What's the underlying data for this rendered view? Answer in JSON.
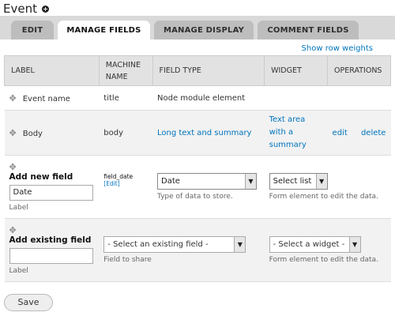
{
  "header": {
    "title": "Event",
    "shortcut_glyph": "+"
  },
  "tabs": [
    {
      "label": "EDIT",
      "active": false
    },
    {
      "label": "MANAGE FIELDS",
      "active": true
    },
    {
      "label": "MANAGE DISPLAY",
      "active": false
    },
    {
      "label": "COMMENT FIELDS",
      "active": false
    }
  ],
  "row_weights_link": "Show row weights",
  "table": {
    "headers": {
      "label": "LABEL",
      "machine_name": "MACHINE NAME",
      "field_type": "FIELD TYPE",
      "widget": "WIDGET",
      "operations": "OPERATIONS"
    },
    "rows": [
      {
        "label": "Event name",
        "machine_name": "title",
        "field_type": "Node module element"
      },
      {
        "label": "Body",
        "machine_name": "body",
        "field_type": "Long text and summary",
        "widget": "Text area with a summary",
        "edit": "edit",
        "delete": "delete"
      }
    ],
    "new_field": {
      "heading": "Add new field",
      "label_value": "Date",
      "label_caption": "Label",
      "machine_name": "field_date",
      "machine_edit": "[Edit]",
      "type_selected": "Date",
      "type_desc": "Type of data to store.",
      "widget_selected": "Select list",
      "widget_desc": "Form element to edit the data."
    },
    "existing_field": {
      "heading": "Add existing field",
      "label_value": "",
      "label_caption": "Label",
      "field_selected": "- Select an existing field -",
      "field_desc": "Field to share",
      "widget_selected": "- Select a widget -",
      "widget_desc": "Form element to edit the data."
    }
  },
  "save_label": "Save",
  "colors": {
    "link": "#0074bd",
    "tab_bar": "#d9d9d9",
    "tab": "#bdbdbd"
  }
}
